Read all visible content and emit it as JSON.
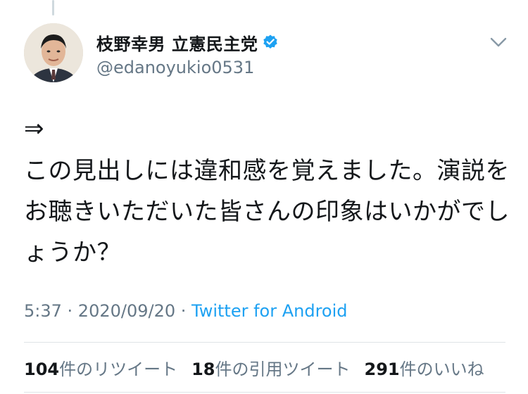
{
  "author": {
    "display_name": "枝野幸男 立憲民主党",
    "handle": "@edanoyukio0531",
    "verified": true
  },
  "tweet": {
    "prefix": "⇒",
    "text": "この見出しには違和感を覚えました。演説をお聴きいただいた皆さんの印象はいかがでしょうか？"
  },
  "meta": {
    "time": "5:37",
    "separator1": " · ",
    "date": "2020/09/20",
    "separator2": " · ",
    "source": "Twitter for Android"
  },
  "stats": {
    "retweets_count": "104",
    "retweets_label": "件のリツイート",
    "quotes_count": "18",
    "quotes_label": "件の引用ツイート",
    "likes_count": "291",
    "likes_label": "件のいいね"
  },
  "colors": {
    "link": "#1da1f2",
    "secondary_text": "#657786",
    "verified": "#1da1f2"
  },
  "icons": {
    "verified": "verified-badge-icon",
    "menu": "chevron-down-icon"
  }
}
